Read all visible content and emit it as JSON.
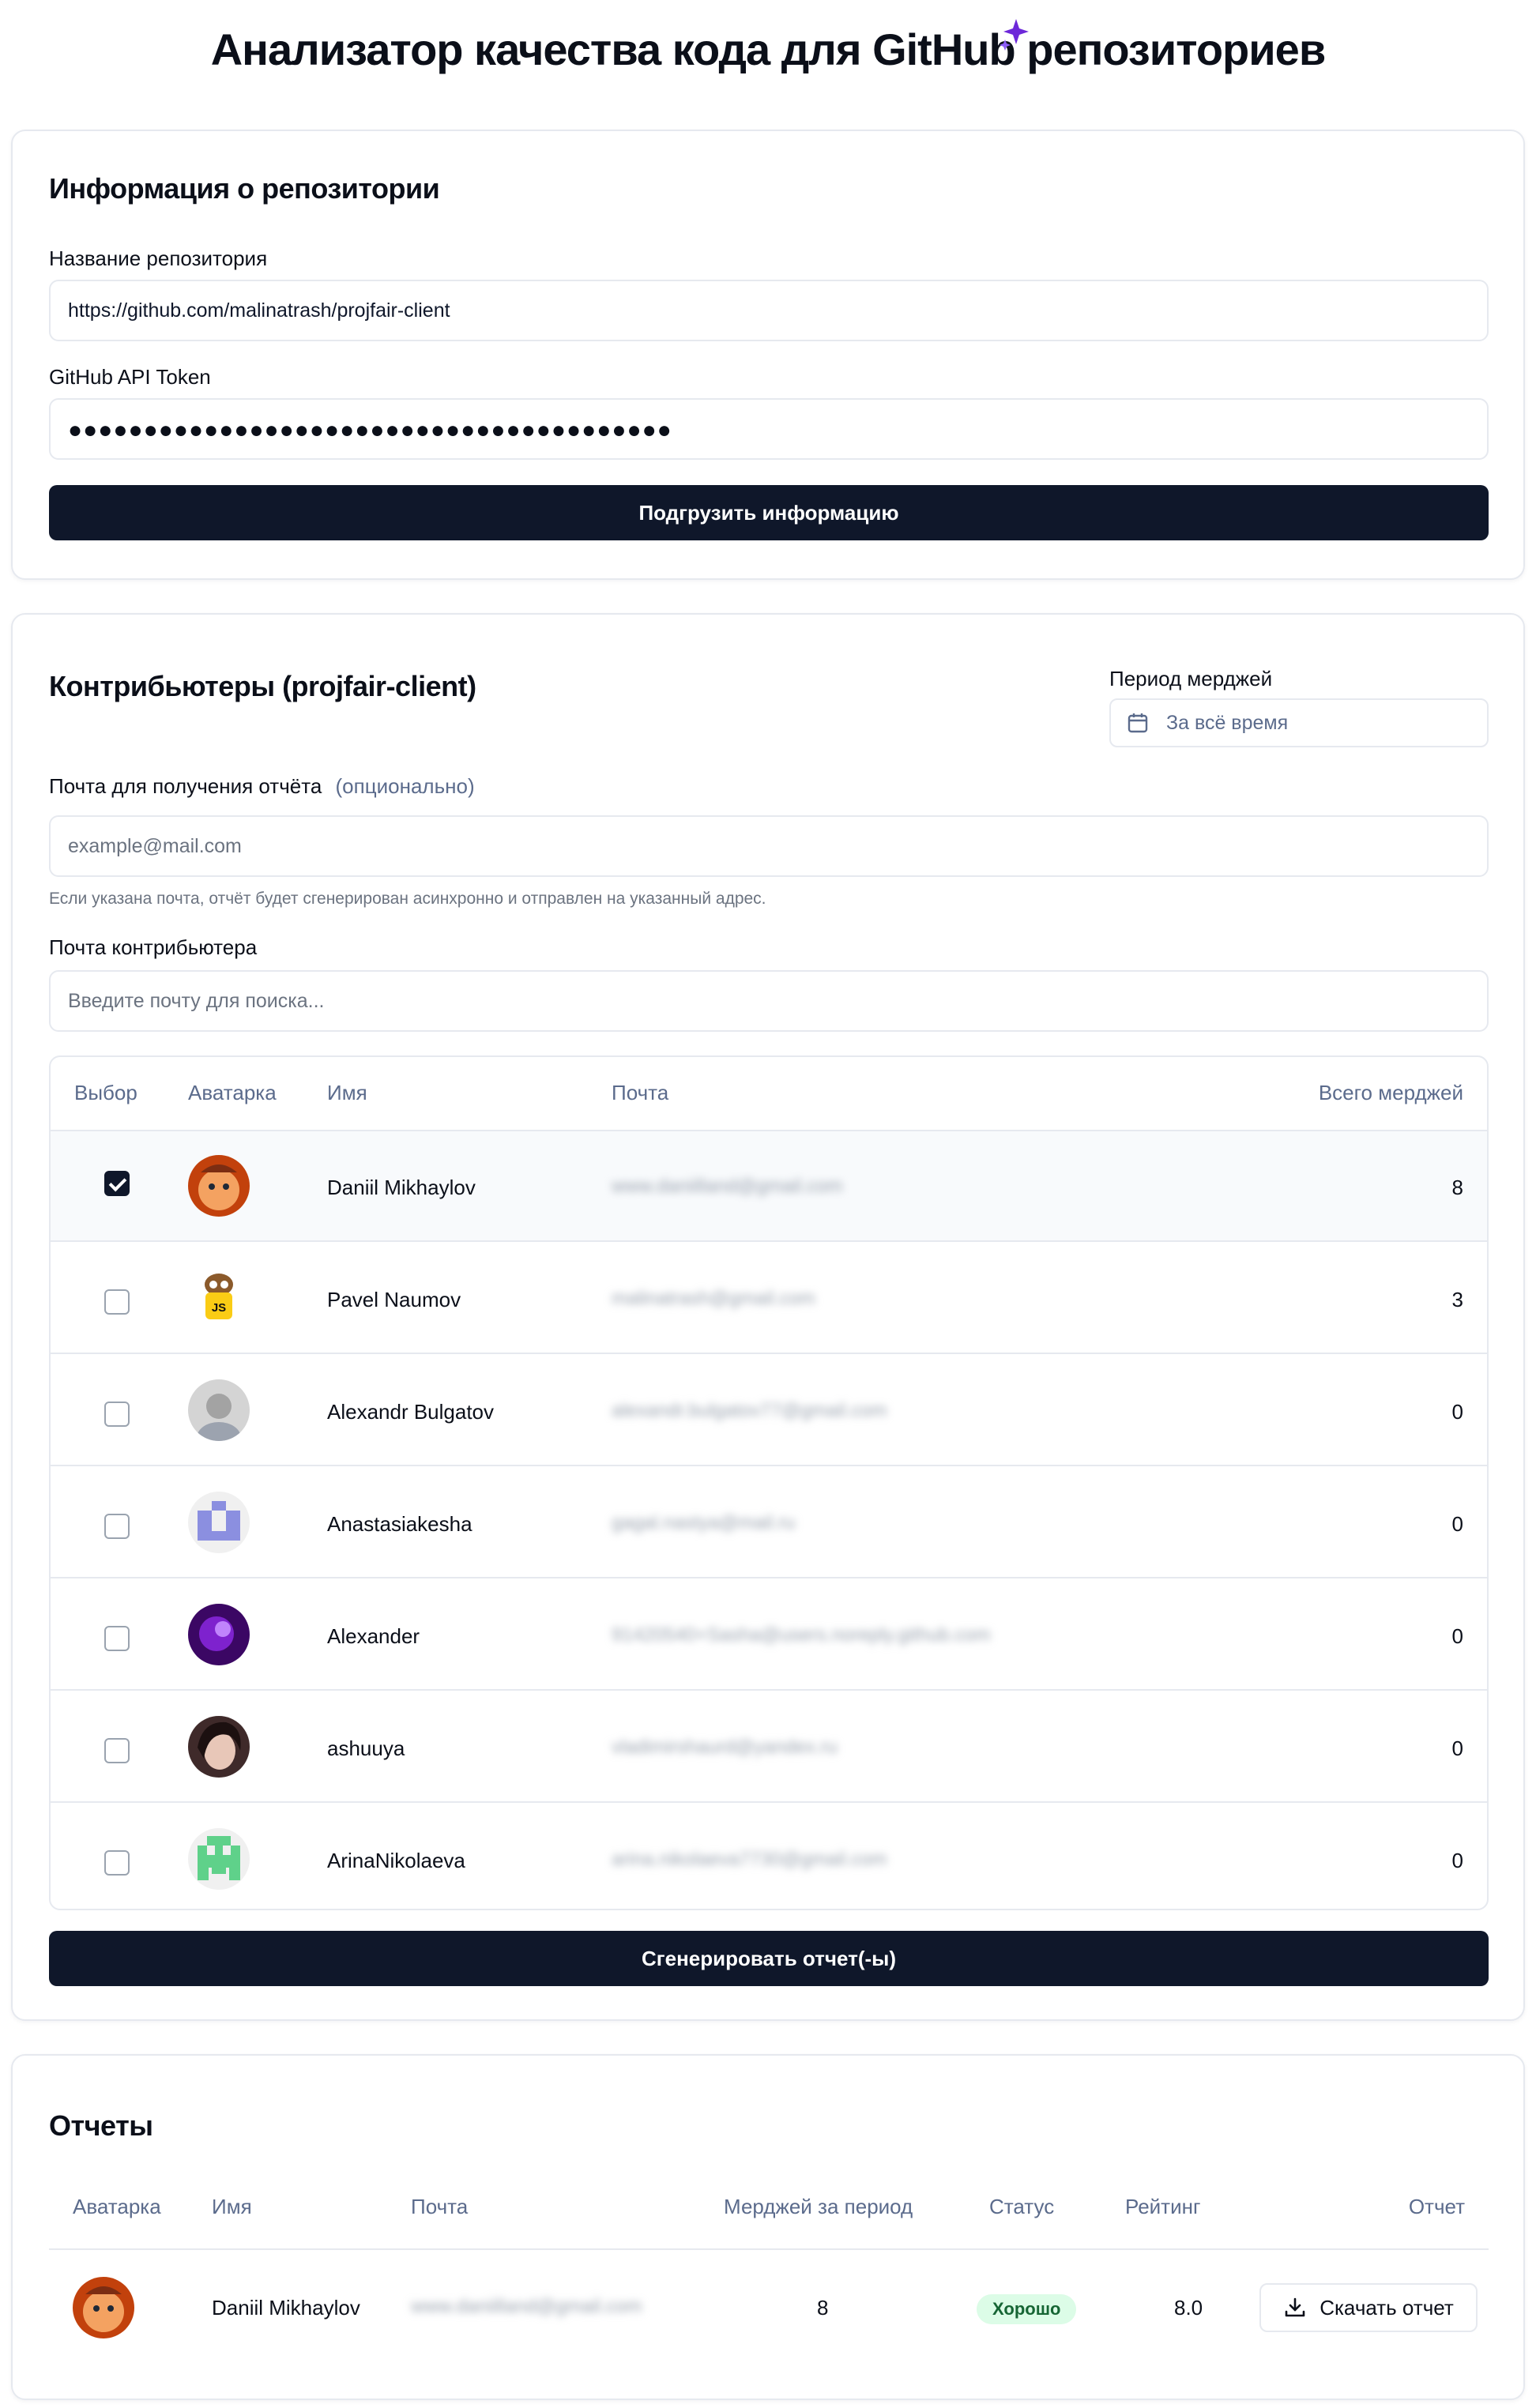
{
  "header": {
    "title": "Анализатор качества кода для GitHub репозиториев"
  },
  "repo_card": {
    "title": "Информация о репозитории",
    "repo_label": "Название репозитория",
    "repo_value": "https://github.com/malinatrash/projfair-client",
    "token_label": "GitHub API Token",
    "token_masked": "●●●●●●●●●●●●●●●●●●●●●●●●●●●●●●●●●●●●●●●●",
    "load_button": "Подгрузить информацию"
  },
  "contributors_card": {
    "title": "Контрибьютеры (projfair-client)",
    "period_label": "Период мерджей",
    "period_value": "За всё время",
    "report_email_label": "Почта для получения отчёта",
    "report_email_optional": "(опционально)",
    "report_email_placeholder": "example@mail.com",
    "report_email_hint": "Если указана почта, отчёт будет сгенерирован асинхронно и отправлен на указанный адрес.",
    "contributor_email_label": "Почта контрибьютера",
    "contributor_email_placeholder": "Введите почту для поиска...",
    "columns": [
      "Выбор",
      "Аватарка",
      "Имя",
      "Почта",
      "Всего мерджей"
    ],
    "rows": [
      {
        "name": "Daniil Mikhaylov",
        "email": "www.daniilland@gmail.com",
        "merges": "8",
        "checked": true
      },
      {
        "name": "Pavel Naumov",
        "email": "malinatrash@gmail.com",
        "merges": "3",
        "checked": false
      },
      {
        "name": "Alexandr Bulgatov",
        "email": "alexandr.bulgatov77@gmail.com",
        "merges": "0",
        "checked": false
      },
      {
        "name": "Anastasiakesha",
        "email": "gagal.nastya@mail.ru",
        "merges": "0",
        "checked": false
      },
      {
        "name": "Alexander",
        "email": "91420540+Sasha@users.noreply.github.com",
        "merges": "0",
        "checked": false
      },
      {
        "name": "ashuuya",
        "email": "vladimirshaurd@yandex.ru",
        "merges": "0",
        "checked": false
      },
      {
        "name": "ArinaNikolaeva",
        "email": "arina.nikolaeva7730@gmail.com",
        "merges": "0",
        "checked": false
      }
    ],
    "generate_button": "Сгенерировать отчет(-ы)"
  },
  "reports_card": {
    "title": "Отчеты",
    "columns": [
      "Аватарка",
      "Имя",
      "Почта",
      "Мерджей за период",
      "Статус",
      "Рейтинг",
      "Отчет"
    ],
    "row": {
      "name": "Daniil Mikhaylov",
      "email": "www.daniilland@gmail.com",
      "merges": "8",
      "status": "Хорошо",
      "rating": "8.0",
      "download": "Скачать отчет"
    }
  },
  "colors": {
    "primary": "#0f172a",
    "muted": "#5b6b8c",
    "border": "#e6e9ef",
    "good_badge": "#dcfce7",
    "sparkle": "#6d28d9"
  }
}
